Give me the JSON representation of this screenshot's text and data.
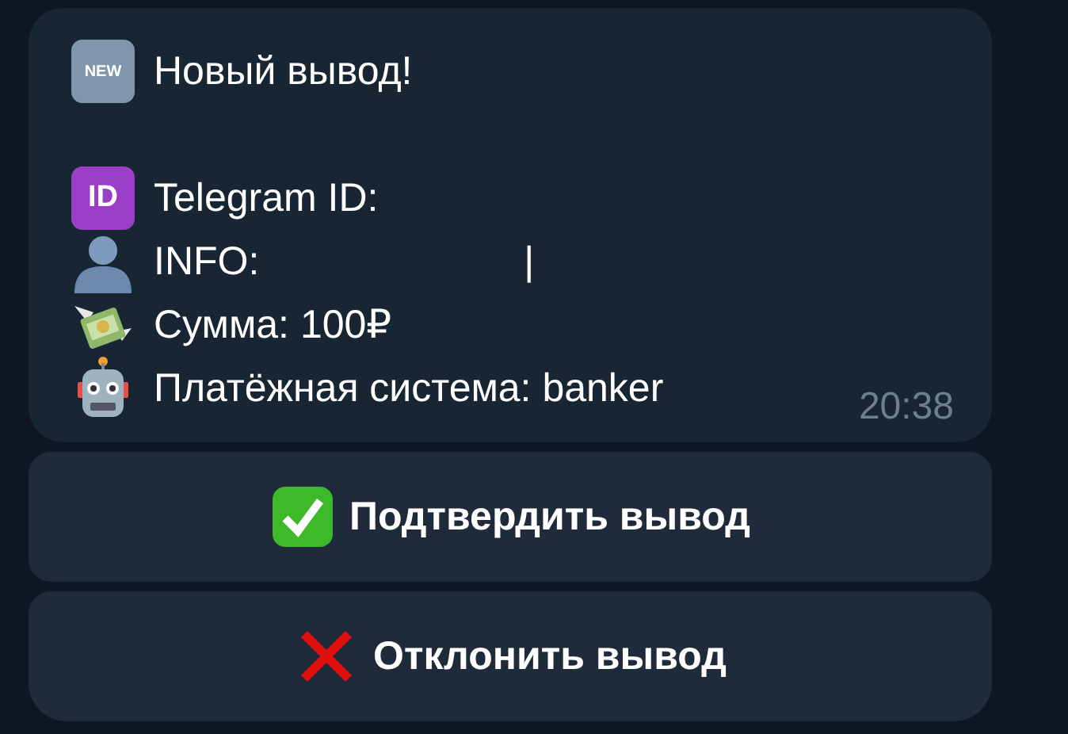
{
  "message": {
    "lines": [
      {
        "kind": "new",
        "badge": "NEW",
        "text": "Новый вывод!"
      },
      {
        "kind": "blank"
      },
      {
        "kind": "id",
        "badge": "ID",
        "text": "Telegram ID:"
      },
      {
        "kind": "person",
        "text": "INFO:",
        "value": "|"
      },
      {
        "kind": "money",
        "text": "Сумма: 100₽"
      },
      {
        "kind": "robot",
        "text": "Платёжная система: banker"
      }
    ],
    "time": "20:38"
  },
  "buttons": [
    {
      "kind": "check",
      "label": "Подтвердить вывод"
    },
    {
      "kind": "cross",
      "label": "Отклонить вывод"
    }
  ]
}
